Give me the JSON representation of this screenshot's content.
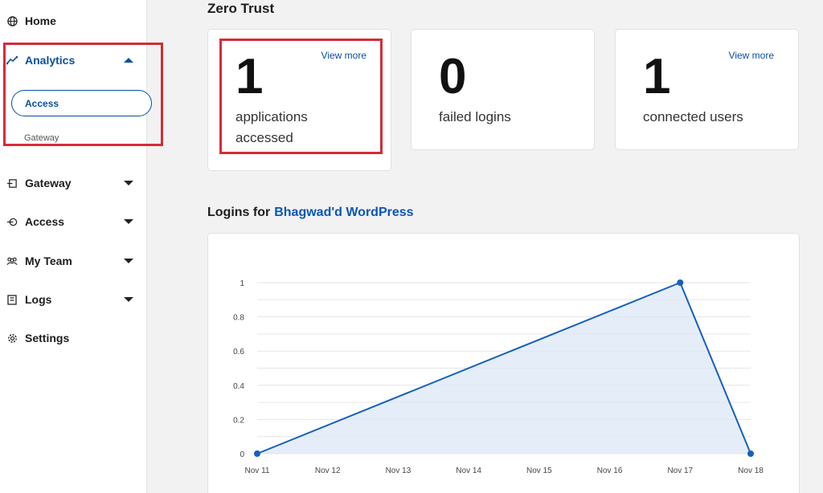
{
  "sidebar": {
    "items": [
      {
        "label": "Home",
        "icon": "globe-icon"
      },
      {
        "label": "Analytics",
        "icon": "analytics-icon",
        "active": true
      },
      {
        "label": "Gateway",
        "icon": "gateway-icon"
      },
      {
        "label": "Access",
        "icon": "access-icon"
      },
      {
        "label": "My Team",
        "icon": "team-icon"
      },
      {
        "label": "Logs",
        "icon": "logs-icon"
      },
      {
        "label": "Settings",
        "icon": "gear-icon"
      }
    ],
    "analytics_sub": {
      "access": "Access",
      "gateway": "Gateway"
    }
  },
  "main": {
    "section_title": "Zero Trust",
    "cards": [
      {
        "value": "1",
        "description": "applications accessed",
        "link": "View more"
      },
      {
        "value": "0",
        "description": "failed logins"
      },
      {
        "value": "1",
        "description": "connected users",
        "link": "View more"
      }
    ],
    "logins_title": "Logins for",
    "logins_app": "Bhagwad'd WordPress"
  },
  "colors": {
    "accent": "#0a4fa3",
    "highlight": "#d62b36",
    "chart_line": "#1560bd",
    "chart_fill": "#dce7f6"
  },
  "chart_data": {
    "type": "area",
    "categories": [
      "Nov 11",
      "Nov 12",
      "Nov 13",
      "Nov 14",
      "Nov 15",
      "Nov 16",
      "Nov 17",
      "Nov 18"
    ],
    "series": [
      {
        "values": [
          0,
          null,
          null,
          null,
          null,
          null,
          1,
          0
        ]
      }
    ],
    "y_ticks": [
      "0",
      "0.2",
      "0.4",
      "0.6",
      "0.8",
      "1"
    ],
    "ylim": [
      0,
      1
    ],
    "grid": true
  }
}
